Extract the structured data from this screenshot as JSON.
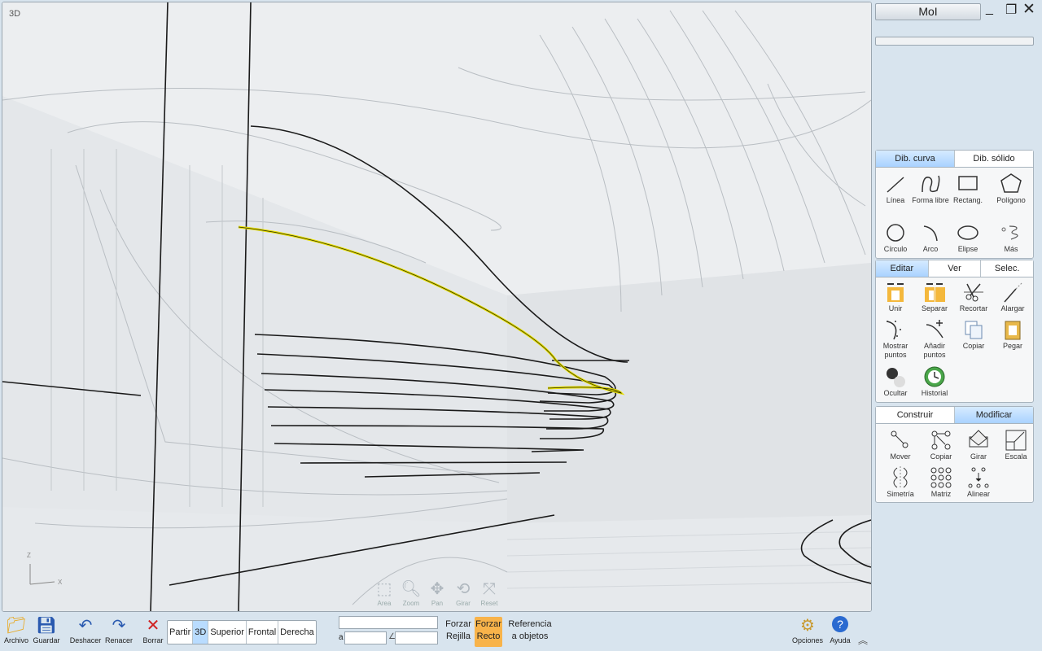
{
  "viewport": {
    "label": "3D",
    "nav": [
      {
        "label": "Area",
        "icon": "zoom-area-icon"
      },
      {
        "label": "Zoom",
        "icon": "zoom-icon"
      },
      {
        "label": "Pan",
        "icon": "pan-icon"
      },
      {
        "label": "Girar",
        "icon": "rotate-icon"
      },
      {
        "label": "Reset",
        "icon": "reset-view-icon"
      }
    ],
    "axes": {
      "z": "Z",
      "x": "X"
    }
  },
  "window": {
    "title": "MoI",
    "minimize": "_",
    "restore": "❐",
    "close": "✕"
  },
  "draw_group": {
    "tabs": [
      {
        "label": "Dib. curva",
        "active": true
      },
      {
        "label": "Dib. sólido",
        "active": false
      }
    ],
    "tools": [
      {
        "label": "Línea",
        "icon": "line-icon"
      },
      {
        "label": "Forma libre",
        "icon": "freeform-curve-icon"
      },
      {
        "label": "Rectang.",
        "icon": "rectangle-icon"
      },
      {
        "label": "Polígono",
        "icon": "polygon-icon"
      },
      {
        "label": "Círculo",
        "icon": "circle-icon"
      },
      {
        "label": "Arco",
        "icon": "arc-icon"
      },
      {
        "label": "Elipse",
        "icon": "ellipse-icon"
      },
      {
        "label": "Más",
        "icon": "more-helix-icon"
      }
    ]
  },
  "edit_group": {
    "tabs": [
      {
        "label": "Editar",
        "active": true
      },
      {
        "label": "Ver",
        "active": false
      },
      {
        "label": "Selec.",
        "active": false
      }
    ],
    "tools": [
      {
        "label": "Unir",
        "icon": "join-icon"
      },
      {
        "label": "Separar",
        "icon": "separate-icon"
      },
      {
        "label": "Recortar",
        "icon": "scissors-icon"
      },
      {
        "label": "Alargar",
        "icon": "extend-icon"
      },
      {
        "label": "Mostrar puntos",
        "icon": "show-points-icon"
      },
      {
        "label": "Añadir puntos",
        "icon": "add-points-icon"
      },
      {
        "label": "Copiar",
        "icon": "copy-icon"
      },
      {
        "label": "Pegar",
        "icon": "paste-icon"
      },
      {
        "label": "Ocultar",
        "icon": "hide-icon"
      },
      {
        "label": "Historial",
        "icon": "history-icon"
      }
    ]
  },
  "transform_group": {
    "tabs": [
      {
        "label": "Construir",
        "active": false
      },
      {
        "label": "Modificar",
        "active": true
      }
    ],
    "tools": [
      {
        "label": "Mover",
        "icon": "move-icon"
      },
      {
        "label": "Copiar",
        "icon": "copy-transform-icon"
      },
      {
        "label": "Girar",
        "icon": "rotate-transform-icon"
      },
      {
        "label": "Escala",
        "icon": "scale-icon"
      },
      {
        "label": "Simetría",
        "icon": "mirror-icon"
      },
      {
        "label": "Matriz",
        "icon": "array-icon"
      },
      {
        "label": "Alinear",
        "icon": "align-icon"
      }
    ]
  },
  "bottom": {
    "buttons": [
      {
        "label": "Archivo",
        "icon": "folder-icon"
      },
      {
        "label": "Guardar",
        "icon": "save-icon"
      },
      {
        "label": "Deshacer",
        "icon": "undo-icon"
      },
      {
        "label": "Renacer",
        "icon": "redo-icon"
      },
      {
        "label": "Borrar",
        "icon": "delete-icon"
      }
    ],
    "views": [
      {
        "label": "Partir",
        "active": false
      },
      {
        "label": "3D",
        "active": true
      },
      {
        "label": "Superior",
        "active": false
      },
      {
        "label": "Frontal",
        "active": false
      },
      {
        "label": "Derecha",
        "active": false
      }
    ],
    "coord_prefix_a": "a",
    "coord_prefix_angle": "∠",
    "snap_grid": "Forzar\nRejilla",
    "snap_straight": "Forzar\nRecto",
    "snap_objects": "Referencia\na objetos",
    "opciones": "Opciones",
    "ayuda": "Ayuda"
  },
  "colors": {
    "accent": "#a9d2ff",
    "snap_active": "#f8b34a",
    "highlight_curve": "#e8e000"
  }
}
